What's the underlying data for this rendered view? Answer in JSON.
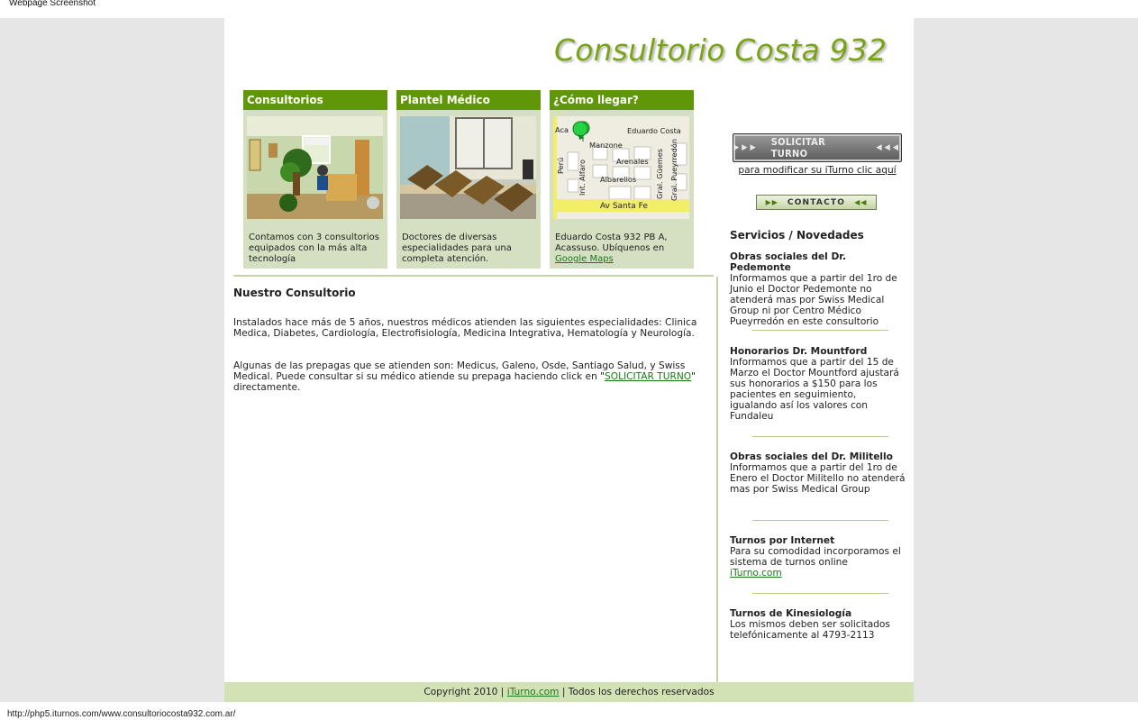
{
  "window": {
    "caption": "Webpage Screenshot"
  },
  "status_bar": {
    "url": "http://php5.iturnos.com/www.consultoriocosta932.com.ar/"
  },
  "header": {
    "title": "Consultorio Costa 932"
  },
  "cards": [
    {
      "title": "Consultorios",
      "text": "Contamos con 3 consultorios equipados con la más alta tecnología"
    },
    {
      "title": "Plantel Médico",
      "text": "Doctores de diversas especialidades para una completa atención."
    },
    {
      "title": "¿Cómo llegar?",
      "text": "Eduardo Costa 932 PB A, Acassuso. Ubíquenos en",
      "link": "Google Maps",
      "map_labels": {
        "acassuso": "Aca",
        "eduardo_costa": "Eduardo Costa",
        "manzone": "Manzone",
        "arenales": "Arenales",
        "peru": "Perú",
        "alfaro": "Int. Alfaro",
        "albarellos": "Albarellos",
        "guemes": "Gral. Güemes",
        "pueyrredon": "Gral. Pueyrredón",
        "santa_fe": "Av Santa Fe"
      }
    }
  ],
  "main": {
    "heading": "Nuestro Consultorio",
    "p1": "Instalados hace más de 5 años, nuestros médicos atienden las siguientes especialidades: Clinica Medica, Diabetes, Cardiología, Electrofisiología, Medicina Integrativa, Hematología y Neurología.",
    "p2_before": "Algunas de las prepagas que se atienden son: Medicus, Galeno, Osde, Santiago Salud, y Swiss Medical. Puede consultar si su médico atiende su prepaga haciendo click en \"",
    "p2_link": "SOLICITAR TURNO",
    "p2_after": "\" directamente."
  },
  "sidebar": {
    "turno_button": "SOLICITAR TURNO",
    "modify_link": "para modificar su iTurno clic aquí",
    "contact_button": "CONTACTO",
    "news_heading": "Servicios / Novedades",
    "news": [
      {
        "title": "Obras sociales del Dr. Pedemonte",
        "text": "Informamos que a partir del 1ro de Junio el Doctor Pedemonte no atenderá mas por Swiss Medical Group ni por Centro Médico Pueyrredón en este consultorio"
      },
      {
        "title": "Honorarios Dr. Mountford",
        "text": "Informamos que a partir del 15 de Marzo el Doctor Mountford ajustará sus honorarios a $150 para los pacientes en seguimiento, igualando así los valores con Fundaleu"
      },
      {
        "title": "Obras sociales del Dr. Militello",
        "text": "Informamos que a partir del 1ro de Enero el Doctor Militello no atenderá mas por Swiss Medical Group"
      },
      {
        "title": "Turnos por Internet",
        "text": "Para su comodidad incorporamos el sistema de turnos online",
        "link": "iTurno.com"
      },
      {
        "title": "Turnos de Kinesiología",
        "text": "Los mismos deben ser solicitados telefónicamente al 4793-2113"
      }
    ]
  },
  "footer": {
    "copyright": "Copyright 2010",
    "separator": "|",
    "link": "iTurno.com",
    "rights": "Todos los derechos reservados"
  },
  "colors": {
    "accent": "#5f9708",
    "title": "#7aa417",
    "card_bg": "#d5dfc2",
    "footer_bg": "#d2e2b5",
    "link": "#197a19"
  }
}
